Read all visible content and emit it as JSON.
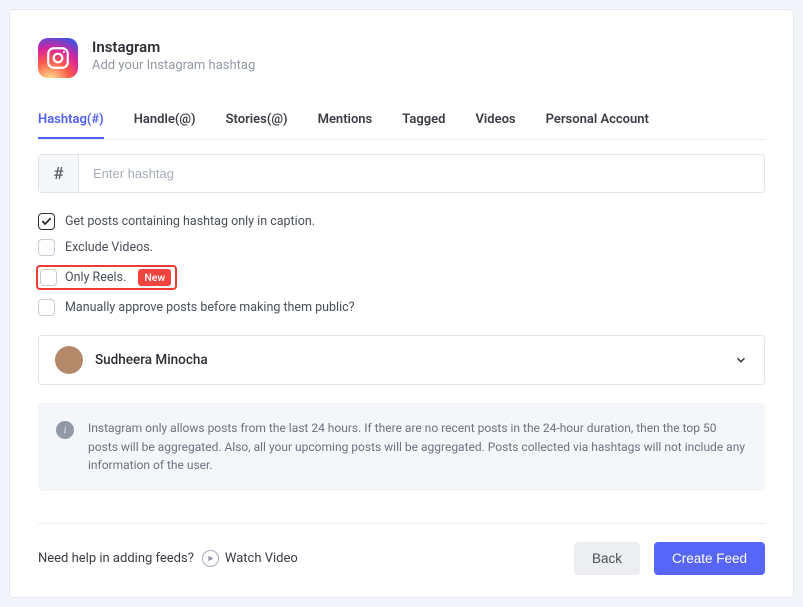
{
  "header": {
    "title": "Instagram",
    "subtitle": "Add your Instagram hashtag"
  },
  "tabs": [
    "Hashtag(#)",
    "Handle(@)",
    "Stories(@)",
    "Mentions",
    "Tagged",
    "Videos",
    "Personal Account"
  ],
  "input": {
    "addon": "#",
    "placeholder": "Enter hashtag"
  },
  "options": {
    "caption": "Get posts containing hashtag only in caption.",
    "exclude_videos": "Exclude Videos.",
    "only_reels": "Only Reels.",
    "only_reels_badge": "New",
    "manual_approve": "Manually approve posts before making them public?"
  },
  "user": {
    "name": "Sudheera Minocha"
  },
  "info": "Instagram only allows posts from the last 24 hours. If there are no recent posts in the 24-hour duration, then the top 50 posts will be aggregated. Also, all your upcoming posts will be aggregated. Posts collected via hashtags will not include any information of the user.",
  "footer": {
    "help": "Need help in adding feeds?",
    "watch": "Watch Video",
    "back": "Back",
    "create": "Create Feed"
  }
}
